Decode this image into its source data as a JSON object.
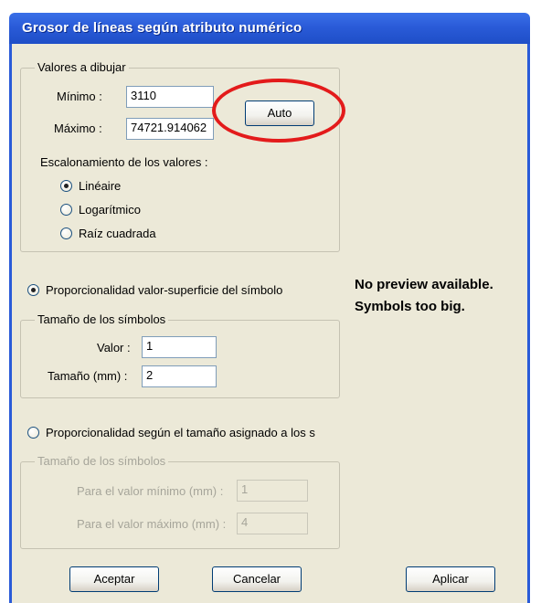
{
  "window": {
    "title": "Grosor de líneas según atributo numérico"
  },
  "valores": {
    "legend": "Valores a dibujar",
    "min_label": "Mínimo :",
    "min_value": "3110",
    "max_label": "Máximo :",
    "max_value": "74721.914062",
    "auto_label": "Auto"
  },
  "escalonamiento": {
    "label": "Escalonamiento de los valores :",
    "options": [
      {
        "label": "Linéaire",
        "selected": true
      },
      {
        "label": "Logarítmico",
        "selected": false
      },
      {
        "label": "Raíz cuadrada",
        "selected": false
      }
    ]
  },
  "prop_superficie": {
    "label": "Proporcionalidad valor-superficie del símbolo",
    "selected": true
  },
  "tamano1": {
    "legend": "Tamaño de los símbolos",
    "valor_label": "Valor :",
    "valor_value": "1",
    "tamano_label": "Tamaño (mm) :",
    "tamano_value": "2"
  },
  "preview": {
    "line1": "No preview available.",
    "line2": "Symbols too big."
  },
  "prop_tamano": {
    "label": "Proporcionalidad según el tamaño asignado a los s",
    "selected": false
  },
  "tamano2": {
    "legend": "Tamaño de los símbolos",
    "min_label": "Para el valor mínimo (mm) :",
    "min_value": "1",
    "max_label": "Para el valor máximo (mm) :",
    "max_value": "4"
  },
  "buttons": {
    "accept": "Aceptar",
    "cancel": "Cancelar",
    "apply": "Aplicar"
  },
  "colors": {
    "titlebar": "#2a5bd8",
    "dialog_bg": "#ece9d8",
    "highlight_circle": "#e31b1b"
  }
}
